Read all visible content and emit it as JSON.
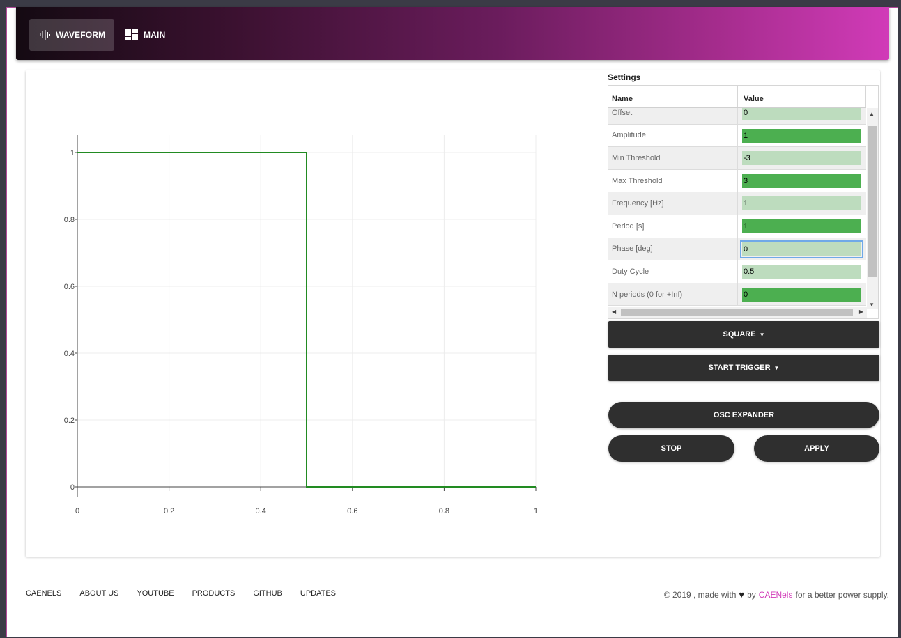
{
  "nav": {
    "tabs": [
      {
        "label": "WAVEFORM",
        "icon": "waveform-icon",
        "active": true
      },
      {
        "label": "MAIN",
        "icon": "dashboard-icon",
        "active": false
      }
    ]
  },
  "settings": {
    "title": "Settings",
    "columns": [
      "Name",
      "Value"
    ],
    "rows": [
      {
        "name": "Offset",
        "value": "0",
        "style": "light"
      },
      {
        "name": "Amplitude",
        "value": "1",
        "style": "dark"
      },
      {
        "name": "Min Threshold",
        "value": "-3",
        "style": "light"
      },
      {
        "name": "Max Threshold",
        "value": "3",
        "style": "dark"
      },
      {
        "name": "Frequency [Hz]",
        "value": "1",
        "style": "light"
      },
      {
        "name": "Period [s]",
        "value": "1",
        "style": "dark"
      },
      {
        "name": "Phase [deg]",
        "value": "0",
        "style": "light",
        "focused": true
      },
      {
        "name": "Duty Cycle",
        "value": "0.5",
        "style": "light"
      },
      {
        "name": "N periods (0 for +Inf)",
        "value": "0",
        "style": "dark"
      }
    ]
  },
  "buttons": {
    "waveform_type": "SQUARE",
    "start_trigger": "START TRIGGER",
    "osc_expander": "OSC EXPANDER",
    "stop": "STOP",
    "apply": "APPLY"
  },
  "footer": {
    "links": [
      "CAENELS",
      "ABOUT US",
      "YOUTUBE",
      "PRODUCTS",
      "GITHUB",
      "UPDATES"
    ],
    "copyright_prefix": "© 2019 , made with",
    "copyright_by": "by",
    "brand": "CAENels",
    "copyright_suffix": "for a better power supply."
  },
  "colors": {
    "line": "#228b22",
    "accent": "#d13bb8",
    "cell_light": "#bddcbe",
    "cell_dark": "#4caf50"
  },
  "chart_data": {
    "type": "line",
    "title": "",
    "xlabel": "",
    "ylabel": "",
    "xlim": [
      0,
      1
    ],
    "ylim": [
      0,
      1
    ],
    "xticks": [
      "0",
      "0.2",
      "0.4",
      "0.6",
      "0.8",
      "1"
    ],
    "yticks": [
      "0",
      "0.2",
      "0.4",
      "0.6",
      "0.8",
      "1"
    ],
    "grid": true,
    "series": [
      {
        "x": [
          0,
          0.5,
          0.5,
          1
        ],
        "y": [
          1,
          1,
          0,
          0
        ]
      }
    ]
  }
}
